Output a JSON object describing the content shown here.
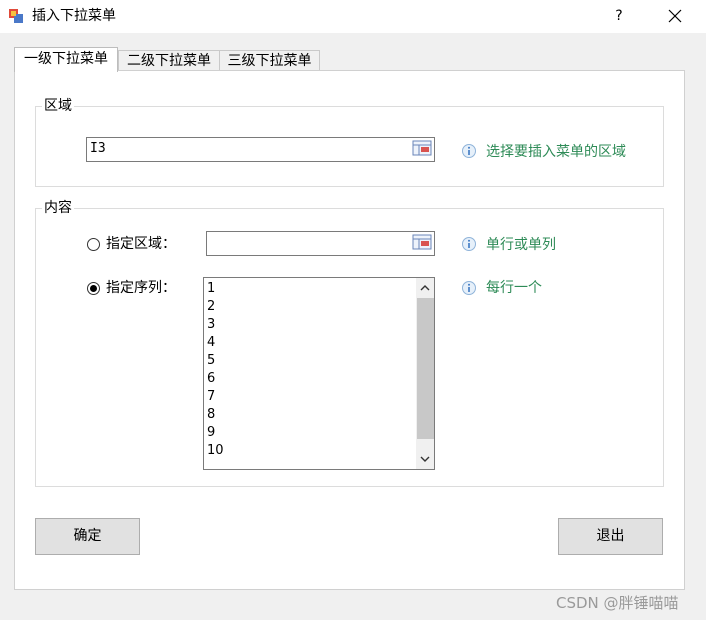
{
  "window": {
    "title": "插入下拉菜单",
    "help_label": "?"
  },
  "tabs": [
    {
      "label": "一级下拉菜单",
      "active": true
    },
    {
      "label": "二级下拉菜单",
      "active": false
    },
    {
      "label": "三级下拉菜单",
      "active": false
    }
  ],
  "region_group": {
    "legend": "区域",
    "input_value": "I3",
    "hint": "选择要插入菜单的区域"
  },
  "content_group": {
    "legend": "内容",
    "option_range": {
      "label": "指定区域：",
      "selected": false,
      "input_value": "",
      "hint": "单行或单列"
    },
    "option_sequence": {
      "label": "指定序列：",
      "selected": true,
      "items": [
        "1",
        "2",
        "3",
        "4",
        "5",
        "6",
        "7",
        "8",
        "9",
        "10"
      ],
      "hint": "每行一个"
    }
  },
  "buttons": {
    "ok_label": "确定",
    "exit_label": "退出"
  },
  "watermark": "CSDN @胖锤喵喵",
  "colors": {
    "hint_text": "#2e8b57",
    "info_icon": "#5a9bd4"
  },
  "icons": [
    "app-icon",
    "close-icon",
    "range-select-icon",
    "info-icon",
    "chevron-up-icon",
    "chevron-down-icon"
  ]
}
